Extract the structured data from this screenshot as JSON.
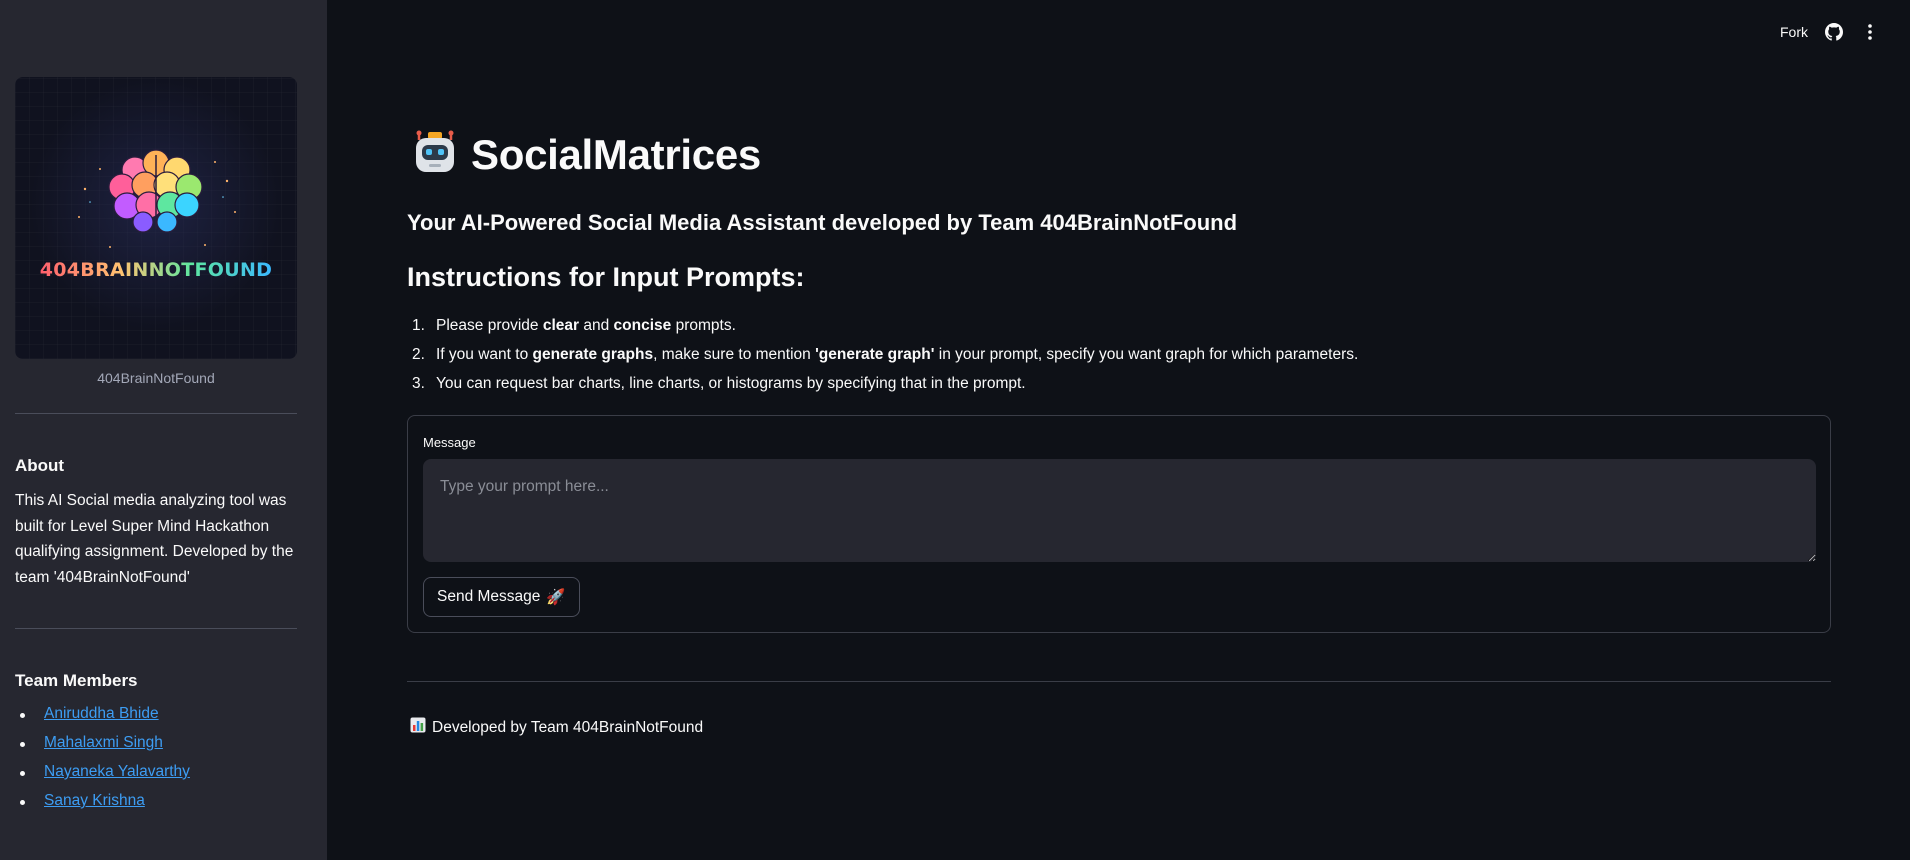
{
  "header": {
    "fork_label": "Fork",
    "github_icon": "github-icon",
    "menu_icon": "kebab-menu-icon"
  },
  "sidebar": {
    "logo_text": "404BRAINNOTFOUND",
    "logo_caption": "404BrainNotFound",
    "about_heading": "About",
    "about_text": "This AI Social media analyzing tool was built for Level Super Mind Hackathon qualifying assignment. Developed by the team '404BrainNotFound'",
    "team_heading": "Team Members",
    "team_members": [
      "Aniruddha Bhide",
      "Mahalaxmi Singh",
      "Nayaneka Yalavarthy",
      "Sanay Krishna"
    ]
  },
  "main": {
    "title_icon": "robot-emoji",
    "title": "SocialMatrices",
    "subtitle": "Your AI-Powered Social Media Assistant developed by Team 404BrainNotFound",
    "instructions_heading": "Instructions for Input Prompts:",
    "instructions": [
      {
        "num": "1.",
        "pre": "Please provide ",
        "b1": "clear",
        "mid": " and ",
        "b2": "concise",
        "post": " prompts."
      },
      {
        "num": "2.",
        "pre": "If you want to ",
        "b1": "generate graphs",
        "mid": ", make sure to mention ",
        "b2": "'generate graph'",
        "post": " in your prompt, specify you want graph for which parameters."
      },
      {
        "num": "3.",
        "text": "You can request bar charts, line charts, or histograms by specifying that in the prompt."
      }
    ],
    "form": {
      "label": "Message",
      "placeholder": "Type your prompt here...",
      "value": "",
      "send_label": "Send Message",
      "send_emoji": "🚀"
    },
    "footer": {
      "icon": "bar-chart-emoji",
      "text": "Developed by Team 404BrainNotFound"
    }
  },
  "colors": {
    "background": "#0e1117",
    "sidebar": "#262730",
    "link": "#3d9df3",
    "text": "#fafafa"
  }
}
